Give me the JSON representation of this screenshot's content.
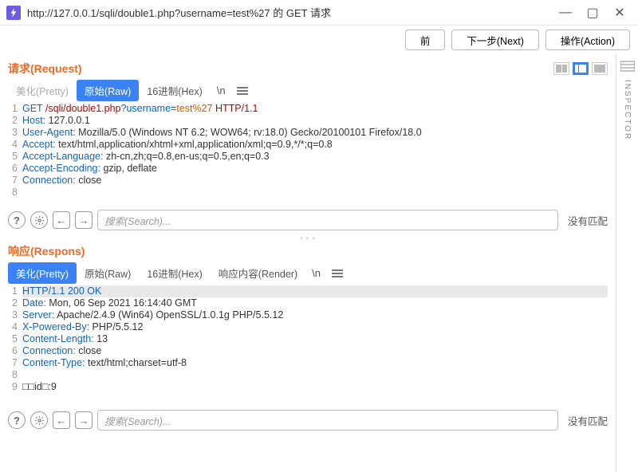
{
  "window": {
    "title": "http://127.0.0.1/sqli/double1.php?username=test%27 的 GET 请求"
  },
  "toolbar": {
    "prev": "前",
    "next": "下一步(Next)",
    "action": "操作(Action)"
  },
  "request": {
    "title": "请求(Request)",
    "tabs": {
      "pretty": "美化(Pretty)",
      "raw": "原始(Raw)",
      "hex": "16进制(Hex)",
      "newline": "\\n"
    },
    "lines": [
      {
        "n": "1",
        "method": "GET ",
        "path": "/sqli/double1.php",
        "q": "?",
        "qk": "username=",
        "qv": "test%27",
        "sp": " ",
        "proto": "HTTP/1.1"
      },
      {
        "n": "2",
        "h": "Host:",
        "v": " 127.0.0.1"
      },
      {
        "n": "3",
        "h": "User-Agent:",
        "v": " Mozilla/5.0 (Windows NT 6.2; WOW64; rv:18.0) Gecko/20100101 Firefox/18.0"
      },
      {
        "n": "4",
        "h": "Accept:",
        "v": " text/html,application/xhtml+xml,application/xml;q=0.9,*/*;q=0.8"
      },
      {
        "n": "5",
        "h": "Accept-Language:",
        "v": " zh-cn,zh;q=0.8,en-us;q=0.5,en;q=0.3"
      },
      {
        "n": "6",
        "h": "Accept-Encoding:",
        "v": " gzip, deflate"
      },
      {
        "n": "7",
        "h": "Connection:",
        "v": " close"
      },
      {
        "n": "8",
        "h": "",
        "v": ""
      }
    ]
  },
  "response": {
    "title": "响应(Respons)",
    "tabs": {
      "pretty": "美化(Pretty)",
      "raw": "原始(Raw)",
      "hex": "16进制(Hex)",
      "render": "响应内容(Render)",
      "newline": "\\n"
    },
    "lines": [
      {
        "n": "1",
        "status": "HTTP/1.1 200 OK"
      },
      {
        "n": "2",
        "h": "Date:",
        "v": " Mon, 06 Sep 2021 16:14:40 GMT"
      },
      {
        "n": "3",
        "h": "Server:",
        "v": " Apache/2.4.9 (Win64) OpenSSL/1.0.1g PHP/5.5.12"
      },
      {
        "n": "4",
        "h": "X-Powered-By:",
        "v": " PHP/5.5.12"
      },
      {
        "n": "5",
        "h": "Content-Length:",
        "v": " 13"
      },
      {
        "n": "6",
        "h": "Connection:",
        "v": " close"
      },
      {
        "n": "7",
        "h": "Content-Type:",
        "v": " text/html;charset=utf-8"
      },
      {
        "n": "8",
        "h": "",
        "v": ""
      },
      {
        "n": "9",
        "body": "□□id□:9"
      }
    ]
  },
  "search": {
    "placeholder": "搜索(Search)...",
    "nomatch": "没有匹配"
  },
  "inspector": "INSPECTOR"
}
